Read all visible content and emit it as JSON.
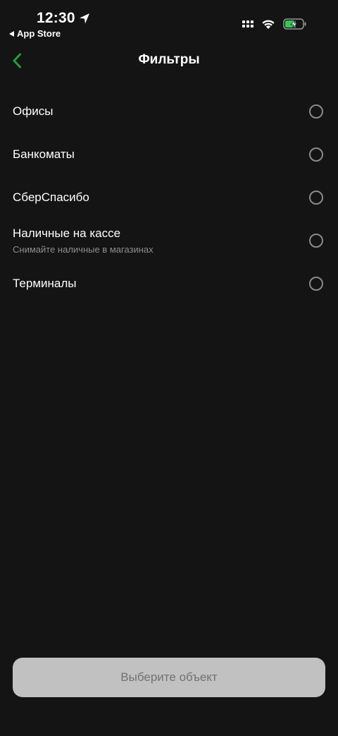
{
  "status_bar": {
    "time": "12:30",
    "back_app_label": "App Store",
    "icons": [
      "location-arrow-icon",
      "cellular-signal-icon",
      "wifi-icon",
      "battery-charging-icon"
    ]
  },
  "nav": {
    "title": "Фильтры",
    "back_icon": "chevron-left-icon"
  },
  "filters": [
    {
      "label": "Офисы",
      "sublabel": "",
      "selected": false
    },
    {
      "label": "Банкоматы",
      "sublabel": "",
      "selected": false
    },
    {
      "label": "СберСпасибо",
      "sublabel": "",
      "selected": false
    },
    {
      "label": "Наличные на кассе",
      "sublabel": "Снимайте наличные в магазинах",
      "selected": false
    },
    {
      "label": "Терминалы",
      "sublabel": "",
      "selected": false
    }
  ],
  "footer": {
    "button_label": "Выберите объект"
  },
  "colors": {
    "background": "#141414",
    "accent_green": "#21a038",
    "button_bg": "#c1c1c1",
    "button_text": "#727272",
    "sublabel": "#8e8e8e",
    "radio_border": "#8a8a8a"
  }
}
